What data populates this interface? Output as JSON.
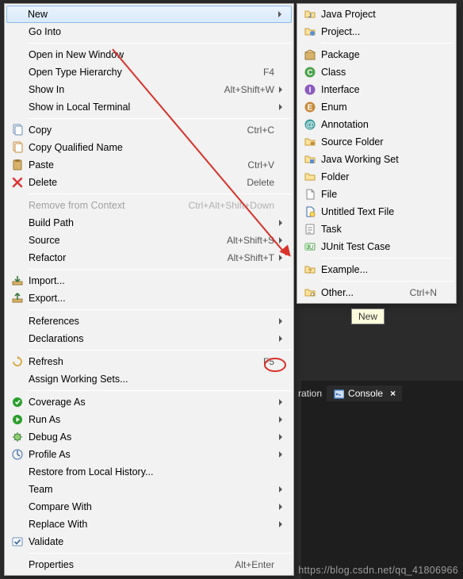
{
  "main_menu": [
    {
      "label": "New",
      "highlight": true,
      "sub": true
    },
    {
      "label": "Go Into"
    },
    {
      "sep": true
    },
    {
      "label": "Open in New Window"
    },
    {
      "label": "Open Type Hierarchy",
      "shortcut": "F4"
    },
    {
      "label": "Show In",
      "shortcut": "Alt+Shift+W",
      "sub": true
    },
    {
      "label": "Show in Local Terminal",
      "sub": true
    },
    {
      "sep": true
    },
    {
      "icon": "copy-icon",
      "label": "Copy",
      "shortcut": "Ctrl+C"
    },
    {
      "icon": "copy-qn-icon",
      "label": "Copy Qualified Name"
    },
    {
      "icon": "paste-icon",
      "label": "Paste",
      "shortcut": "Ctrl+V"
    },
    {
      "icon": "delete-icon",
      "label": "Delete",
      "shortcut": "Delete"
    },
    {
      "sep": true
    },
    {
      "label": "Remove from Context",
      "shortcut": "Ctrl+Alt+Shift+Down",
      "disabled": true
    },
    {
      "label": "Build Path",
      "sub": true
    },
    {
      "label": "Source",
      "shortcut": "Alt+Shift+S",
      "sub": true
    },
    {
      "label": "Refactor",
      "shortcut": "Alt+Shift+T",
      "sub": true
    },
    {
      "sep": true
    },
    {
      "icon": "import-icon",
      "label": "Import..."
    },
    {
      "icon": "export-icon",
      "label": "Export..."
    },
    {
      "sep": true
    },
    {
      "label": "References",
      "sub": true
    },
    {
      "label": "Declarations",
      "sub": true
    },
    {
      "sep": true
    },
    {
      "icon": "refresh-icon",
      "label": "Refresh",
      "shortcut": "F5"
    },
    {
      "label": "Assign Working Sets..."
    },
    {
      "sep": true
    },
    {
      "icon": "coverage-icon",
      "label": "Coverage As",
      "sub": true
    },
    {
      "icon": "run-icon",
      "label": "Run As",
      "sub": true
    },
    {
      "icon": "debug-icon",
      "label": "Debug As",
      "sub": true
    },
    {
      "icon": "profile-icon",
      "label": "Profile As",
      "sub": true
    },
    {
      "label": "Restore from Local History..."
    },
    {
      "label": "Team",
      "sub": true
    },
    {
      "label": "Compare With",
      "sub": true
    },
    {
      "label": "Replace With",
      "sub": true
    },
    {
      "icon": "validate-icon",
      "label": "Validate"
    },
    {
      "sep": true
    },
    {
      "label": "Properties",
      "shortcut": "Alt+Enter"
    }
  ],
  "sub_menu": [
    {
      "icon": "java-project-icon",
      "label": "Java Project"
    },
    {
      "icon": "project-icon",
      "label": "Project..."
    },
    {
      "sep": true
    },
    {
      "icon": "package-icon",
      "label": "Package"
    },
    {
      "icon": "class-icon",
      "label": "Class"
    },
    {
      "icon": "interface-icon",
      "label": "Interface"
    },
    {
      "icon": "enum-icon",
      "label": "Enum"
    },
    {
      "icon": "annotation-icon",
      "label": "Annotation"
    },
    {
      "icon": "source-folder-icon",
      "label": "Source Folder"
    },
    {
      "icon": "working-set-icon",
      "label": "Java Working Set"
    },
    {
      "icon": "folder-icon",
      "label": "Folder"
    },
    {
      "icon": "file-icon",
      "label": "File"
    },
    {
      "icon": "untitled-file-icon",
      "label": "Untitled Text File"
    },
    {
      "icon": "task-icon",
      "label": "Task"
    },
    {
      "icon": "junit-icon",
      "label": "JUnit Test Case"
    },
    {
      "sep": true
    },
    {
      "icon": "example-icon",
      "label": "Example..."
    },
    {
      "sep": true
    },
    {
      "icon": "other-icon",
      "label": "Other...",
      "shortcut": "Ctrl+N"
    }
  ],
  "tooltip": "New",
  "tabs": {
    "partial": "ration",
    "active": "Console"
  },
  "watermark": "https://blog.csdn.net/qq_41806966"
}
